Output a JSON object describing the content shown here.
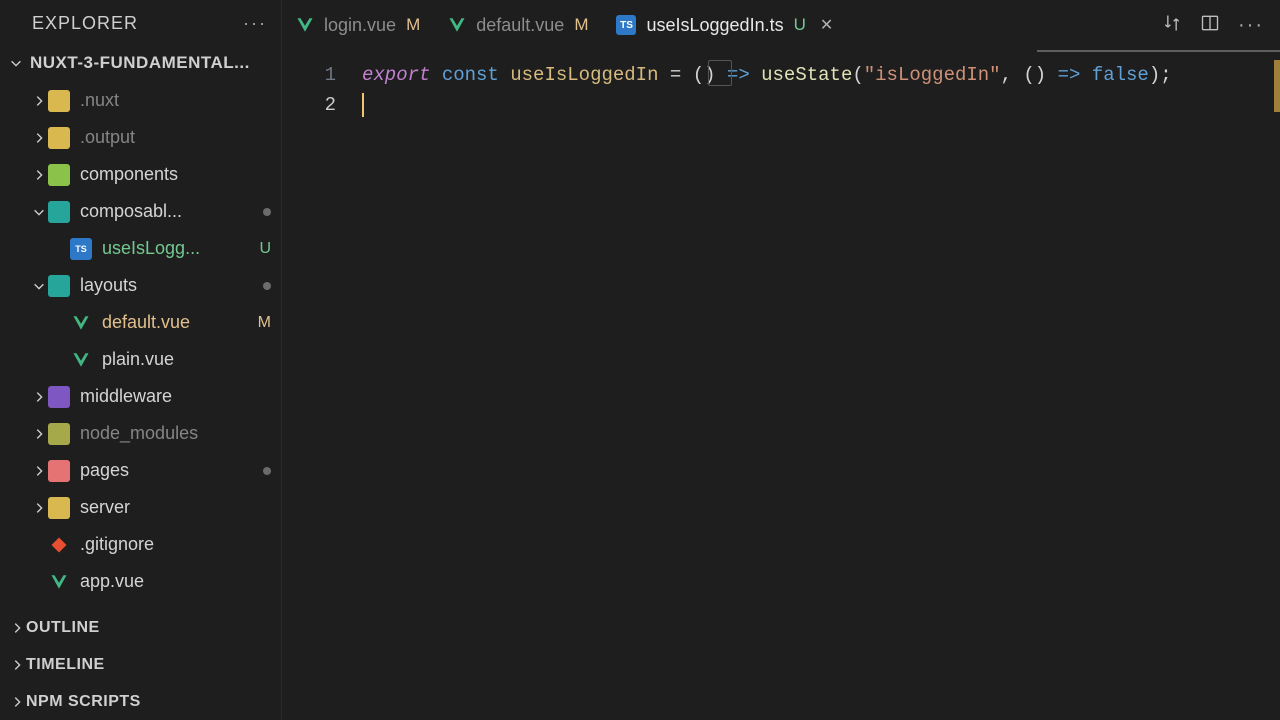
{
  "explorer": {
    "title": "EXPLORER",
    "actions": "···",
    "project_name": "NUXT-3-FUNDAMENTAL..."
  },
  "tree": {
    "items": [
      {
        "label": ".nuxt",
        "variant": "muted",
        "depth": 1,
        "icon": "folder-yellow",
        "arrow": ">"
      },
      {
        "label": ".output",
        "variant": "muted",
        "depth": 1,
        "icon": "folder-yellow",
        "arrow": ">"
      },
      {
        "label": "components",
        "variant": "",
        "depth": 1,
        "icon": "folder-green",
        "arrow": ">"
      },
      {
        "label": "composabl...",
        "variant": "",
        "depth": 1,
        "icon": "folder-teal",
        "arrow": "v",
        "dot": true
      },
      {
        "label": "useIsLogg...",
        "variant": "git-added",
        "depth": 2,
        "icon": "ts",
        "arrow": "",
        "status": "U"
      },
      {
        "label": "layouts",
        "variant": "",
        "depth": 1,
        "icon": "folder-teal",
        "arrow": "v",
        "dot": true
      },
      {
        "label": "default.vue",
        "variant": "git-modified-txt",
        "depth": 2,
        "icon": "vue",
        "arrow": "",
        "status": "M"
      },
      {
        "label": "plain.vue",
        "variant": "",
        "depth": 2,
        "icon": "vue",
        "arrow": ""
      },
      {
        "label": "middleware",
        "variant": "",
        "depth": 1,
        "icon": "folder-purple",
        "arrow": ">"
      },
      {
        "label": "node_modules",
        "variant": "muted",
        "depth": 1,
        "icon": "folder-olive",
        "arrow": ">"
      },
      {
        "label": "pages",
        "variant": "",
        "depth": 1,
        "icon": "folder-red",
        "arrow": ">",
        "dot": true
      },
      {
        "label": "server",
        "variant": "",
        "depth": 1,
        "icon": "folder-yellow",
        "arrow": ">"
      },
      {
        "label": ".gitignore",
        "variant": "",
        "depth": 1,
        "icon": "git",
        "arrow": ""
      },
      {
        "label": "app.vue",
        "variant": "",
        "depth": 1,
        "icon": "vue",
        "arrow": ""
      }
    ]
  },
  "panels": {
    "outline": "OUTLINE",
    "timeline": "TIMELINE",
    "npm": "NPM SCRIPTS"
  },
  "tabs": {
    "items": [
      {
        "label": "login.vue",
        "icon": "vue",
        "status": "M",
        "active": false
      },
      {
        "label": "default.vue",
        "icon": "vue",
        "status": "M",
        "active": false
      },
      {
        "label": "useIsLoggedIn.ts",
        "icon": "ts",
        "status": "U",
        "active": true,
        "closable": true
      }
    ]
  },
  "editor": {
    "lines": [
      "1",
      "2"
    ],
    "code": {
      "k_export": "export",
      "k_const": "const",
      "ident": "useIsLoggedIn",
      "eq": " = ",
      "parens1": "()",
      "arrow": " => ",
      "fn": "useState",
      "open": "(",
      "str": "\"isLoggedIn\"",
      "comma": ", ",
      "parens2": "()",
      "arrow2": " => ",
      "bool": "false",
      "close": ");"
    }
  }
}
